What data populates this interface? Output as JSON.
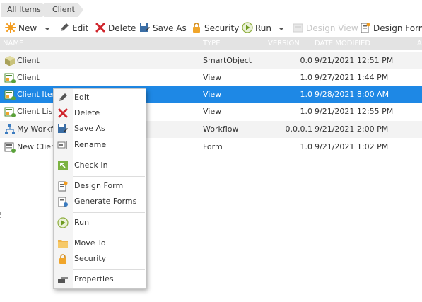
{
  "breadcrumb": {
    "items": [
      "All Items",
      "Client"
    ]
  },
  "toolbar": {
    "new": "New",
    "edit": "Edit",
    "delete": "Delete",
    "save_as": "Save As",
    "security": "Security",
    "run": "Run",
    "design_view": "Design View",
    "design_form": "Design Form"
  },
  "columns": {
    "name": "NAME",
    "type": "TYPE",
    "version": "VERSION",
    "date_modified": "DATE MODIFIED",
    "extra": "A"
  },
  "rows": [
    {
      "icon": "smartobject-icon",
      "name": "Client",
      "type": "SmartObject",
      "version": "0.0",
      "date": "9/21/2021 12:51 PM"
    },
    {
      "icon": "view-icon",
      "name": "Client",
      "type": "View",
      "version": "1.0",
      "date": "9/27/2021 1:44 PM"
    },
    {
      "icon": "view-icon",
      "name": "Client Item",
      "type": "View",
      "version": "1.0",
      "date": "9/28/2021 8:00 AM"
    },
    {
      "icon": "view-icon",
      "name": "Client List",
      "type": "View",
      "version": "1.0",
      "date": "9/21/2021 12:55 PM"
    },
    {
      "icon": "workflow-icon",
      "name": "My Workflow",
      "type": "Workflow",
      "version": "0.0.0.1",
      "date": "9/21/2021 2:00 PM"
    },
    {
      "icon": "form-icon",
      "name": "New Client",
      "type": "Form",
      "version": "1.0",
      "date": "9/21/2021 1:02 PM"
    }
  ],
  "context_menu": {
    "edit": "Edit",
    "delete": "Delete",
    "save_as": "Save As",
    "rename": "Rename",
    "check_in": "Check In",
    "design_form": "Design Form",
    "generate_forms": "Generate Forms",
    "run": "Run",
    "move_to": "Move To",
    "security": "Security",
    "properties": "Properties"
  },
  "colors": {
    "selection": "#1e88e5",
    "header": "#e3e3e3",
    "alt_row": "#f3f3f3"
  }
}
